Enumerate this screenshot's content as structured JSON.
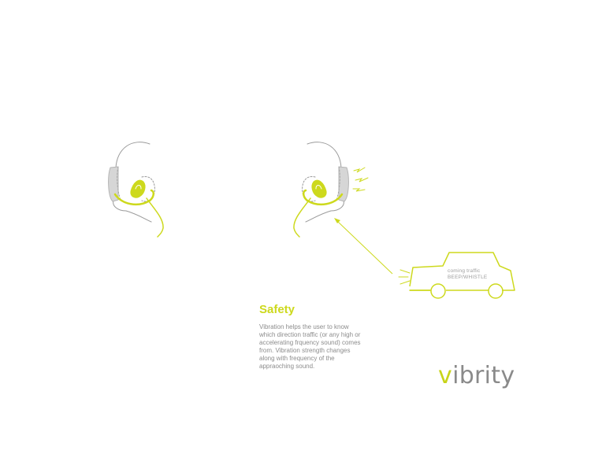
{
  "colors": {
    "accent": "#cdd91d",
    "gray": "#9a9a9a",
    "text": "#8c8c8c"
  },
  "illustrations": [
    {
      "name": "earphone-left-ear",
      "icon": "ear-with-earbud"
    },
    {
      "name": "earphone-right-ear-vibrating",
      "icon": "ear-with-earbud-vibration"
    },
    {
      "name": "car",
      "icon": "car-outline"
    }
  ],
  "car": {
    "label_line1": "coming traffic",
    "label_line2": "BEEP/WHISTLE"
  },
  "section": {
    "title": "Safety",
    "description": "Vibration helps the user to know which direction traffic (or any high or accelerating frquency sound) comes from. Vibration strength changes along with frequency of the appraoching sound."
  },
  "logo": {
    "first_letter": "v",
    "rest": "ibrity"
  }
}
